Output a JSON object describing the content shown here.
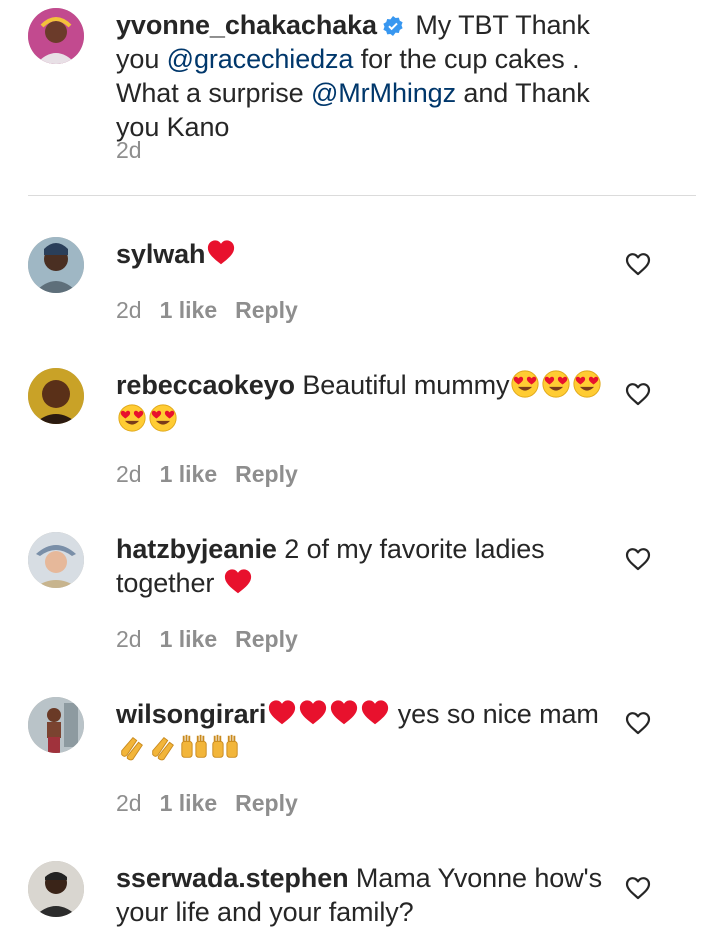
{
  "caption": {
    "username": "yvonne_chakachaka",
    "text_1": " My TBT Thank you ",
    "mention_1": "@gracechiedza",
    "text_2": " for the cup cakes . What a surprise ",
    "mention_2": "@MrMhingz",
    "text_3": " and Thank you Kano",
    "time": "2d"
  },
  "comments": [
    {
      "username": "sylwah",
      "text": "",
      "emoji": [
        "red-heart"
      ],
      "time": "2d",
      "likes": "1 like",
      "reply": "Reply"
    },
    {
      "username": "rebeccaokeyo",
      "text": " Beautiful mummy",
      "emoji": [
        "heart-eyes",
        "heart-eyes",
        "heart-eyes",
        "heart-eyes",
        "heart-eyes"
      ],
      "time": "2d",
      "likes": "1 like",
      "reply": "Reply"
    },
    {
      "username": "hatzbyjeanie",
      "text": " 2 of my favorite ladies together ",
      "emoji": [
        "red-heart"
      ],
      "time": "2d",
      "likes": "1 like",
      "reply": "Reply"
    },
    {
      "username": "wilsongirari",
      "text_a": " yes so nice mam",
      "emoji_a": [
        "red-heart",
        "red-heart",
        "red-heart",
        "red-heart"
      ],
      "emoji_b": [
        "clapping-hands",
        "clapping-hands",
        "raising-hands",
        "raising-hands"
      ],
      "time": "2d",
      "likes": "1 like",
      "reply": "Reply"
    },
    {
      "username": "sserwada.stephen",
      "text": " Mama Yvonne how's your life and your family?"
    }
  ],
  "icons": {
    "like": "heart-outline-icon",
    "verified": "verified-badge-icon"
  },
  "colors": {
    "text": "#262626",
    "muted": "#8e8e8e",
    "mention": "#00376b",
    "verified": "#3897f0",
    "heart_red": "#e8112d"
  }
}
